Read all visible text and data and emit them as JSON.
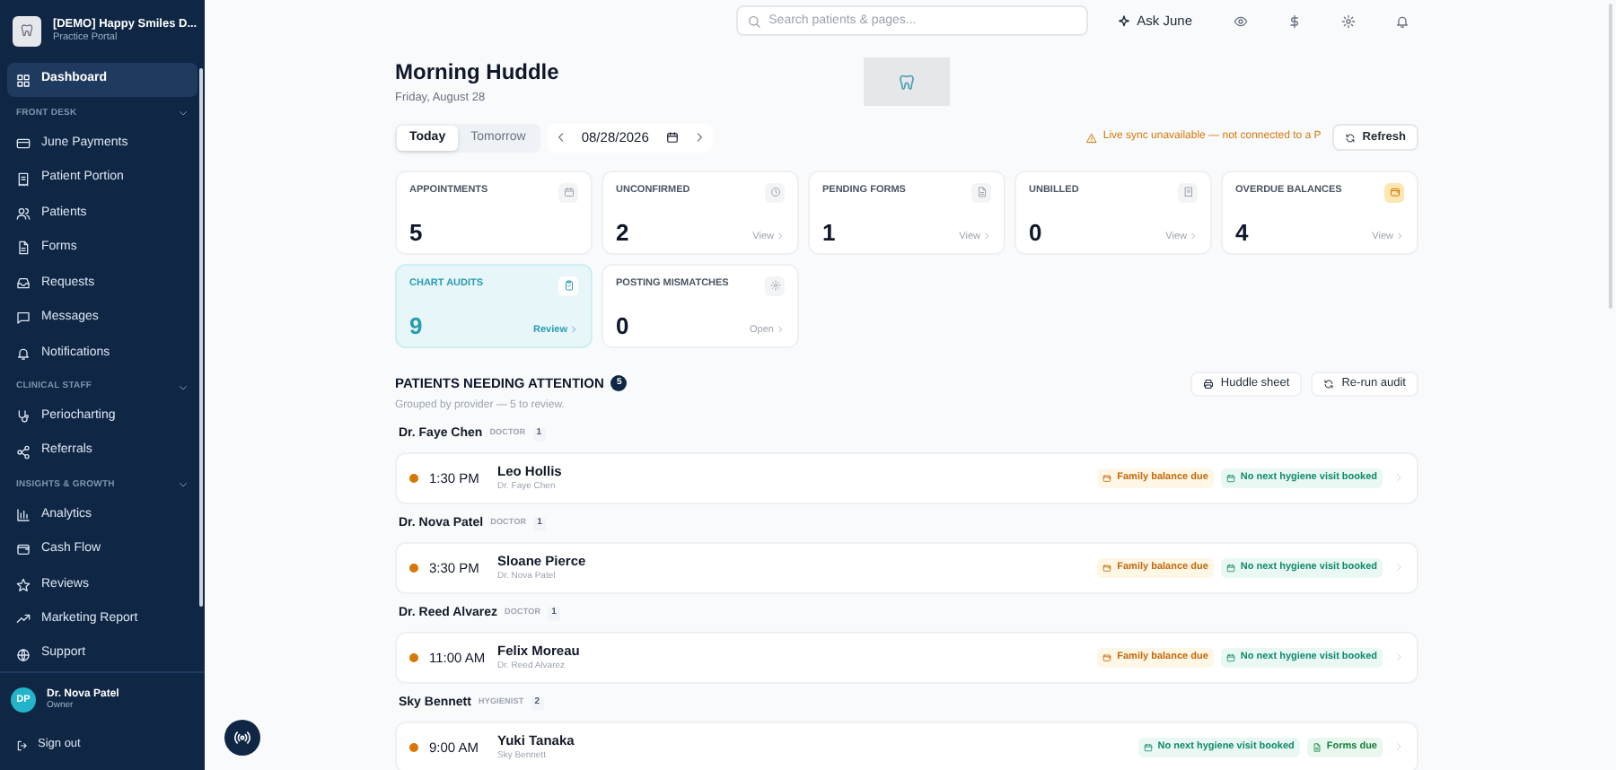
{
  "sidebar": {
    "org_name": "[DEMO] Happy Smiles D...",
    "org_subtitle": "Practice Portal",
    "sections": [
      {
        "items": [
          {
            "label": "Dashboard",
            "selected": true
          }
        ]
      },
      {
        "title": "FRONT DESK",
        "items": [
          {
            "label": "June Payments",
            "selected": false
          },
          {
            "label": "Patient Portion",
            "selected": false
          },
          {
            "label": "Patients",
            "selected": false
          },
          {
            "label": "Forms",
            "selected": false
          },
          {
            "label": "Requests",
            "selected": false
          },
          {
            "label": "Messages",
            "selected": false
          },
          {
            "label": "Notifications",
            "selected": false
          }
        ]
      },
      {
        "title": "CLINICAL STAFF",
        "items": [
          {
            "label": "Periocharting",
            "selected": false
          },
          {
            "label": "Referrals",
            "selected": false
          }
        ]
      },
      {
        "title": "INSIGHTS & GROWTH",
        "items": [
          {
            "label": "Analytics",
            "selected": false
          },
          {
            "label": "Cash Flow",
            "selected": false
          },
          {
            "label": "Reviews",
            "selected": false
          },
          {
            "label": "Marketing Report",
            "selected": false
          }
        ]
      }
    ],
    "support": "Support",
    "user": {
      "initials": "DP",
      "name": "Dr. Nova Patel",
      "role": "Owner"
    },
    "sign_out": "Sign out"
  },
  "topbar": {
    "search_placeholder": "Search patients & pages...",
    "ask": "Ask June"
  },
  "page": {
    "title": "Morning Huddle",
    "subtitle": "Friday, August 28",
    "day_tabs": [
      {
        "label": "Today",
        "selected": true
      },
      {
        "label": "Tomorrow",
        "selected": false
      }
    ],
    "date": "08/28/2026",
    "sync_warning": "Live sync unavailable — not connected to a P",
    "refresh": "Refresh"
  },
  "stats": [
    {
      "label": "APPOINTMENTS",
      "value": "5",
      "highlighted": false,
      "alert": false
    },
    {
      "label": "UNCONFIRMED",
      "value": "2",
      "link": "View",
      "highlighted": false,
      "alert": false
    },
    {
      "label": "PENDING FORMS",
      "value": "1",
      "link": "View",
      "highlighted": false,
      "alert": false
    },
    {
      "label": "UNBILLED",
      "value": "0",
      "link": "View",
      "highlighted": false,
      "alert": false
    },
    {
      "label": "OVERDUE BALANCES",
      "value": "4",
      "link": "View",
      "highlighted": false,
      "alert": true
    },
    {
      "label": "CHART AUDITS",
      "value": "9",
      "link": "Review",
      "highlighted": true,
      "alert": false
    },
    {
      "label": "POSTING MISMATCHES",
      "value": "0",
      "link": "Open",
      "highlighted": false,
      "alert": false
    }
  ],
  "attention": {
    "title": "PATIENTS NEEDING ATTENTION",
    "count": "5",
    "subtitle": "Grouped by provider — 5 to review.",
    "actions": [
      "Huddle sheet",
      "Re-run audit"
    ],
    "groups": [
      {
        "provider": "Dr. Faye Chen",
        "role": "DOCTOR",
        "count": "1",
        "patients": [
          {
            "time": "1:30 PM",
            "name": "Leo Hollis",
            "provider": "Dr. Faye Chen",
            "color": "#d97706",
            "tags": [
              {
                "kind": "balance",
                "label": "Family balance due"
              },
              {
                "kind": "hygiene",
                "label": "No next hygiene visit booked"
              }
            ]
          }
        ]
      },
      {
        "provider": "Dr. Nova Patel",
        "role": "DOCTOR",
        "count": "1",
        "patients": [
          {
            "time": "3:30 PM",
            "name": "Sloane Pierce",
            "provider": "Dr. Nova Patel",
            "color": "#d97706",
            "tags": [
              {
                "kind": "balance",
                "label": "Family balance due"
              },
              {
                "kind": "hygiene",
                "label": "No next hygiene visit booked"
              }
            ]
          }
        ]
      },
      {
        "provider": "Dr. Reed Alvarez",
        "role": "DOCTOR",
        "count": "1",
        "patients": [
          {
            "time": "11:00 AM",
            "name": "Felix Moreau",
            "provider": "Dr. Reed Alvarez",
            "color": "#d97706",
            "tags": [
              {
                "kind": "balance",
                "label": "Family balance due"
              },
              {
                "kind": "hygiene",
                "label": "No next hygiene visit booked"
              }
            ]
          }
        ]
      },
      {
        "provider": "Sky Bennett",
        "role": "HYGIENIST",
        "count": "2",
        "patients": [
          {
            "time": "9:00 AM",
            "name": "Yuki Tanaka",
            "provider": "Sky Bennett",
            "color": "#d97706",
            "tags": [
              {
                "kind": "hygiene",
                "label": "No next hygiene visit booked"
              },
              {
                "kind": "forms",
                "label": "Forms due"
              }
            ]
          }
        ]
      }
    ]
  }
}
